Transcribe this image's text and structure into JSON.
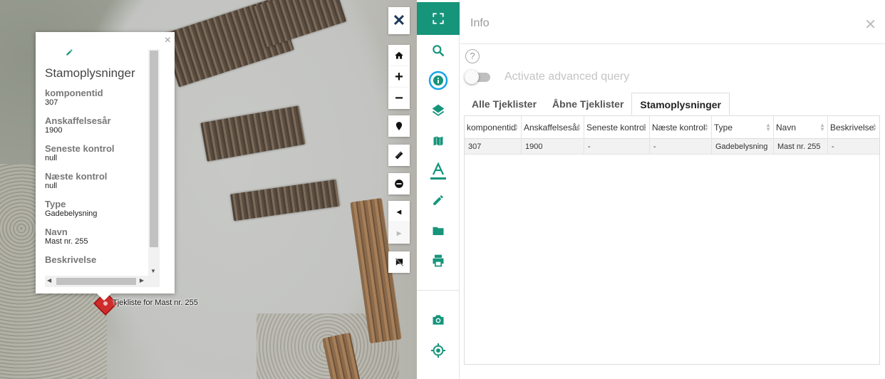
{
  "map": {
    "marker_label": "Tjekliste for Mast nr. 255"
  },
  "popup": {
    "title": "Stamoplysninger",
    "fields": [
      {
        "label": "komponentid",
        "value": "307"
      },
      {
        "label": "Anskaffelsesår",
        "value": "1900"
      },
      {
        "label": "Seneste kontrol",
        "value": "null"
      },
      {
        "label": "Næste kontrol",
        "value": "null"
      },
      {
        "label": "Type",
        "value": "Gadebelysning"
      },
      {
        "label": "Navn",
        "value": "Mast nr. 255"
      },
      {
        "label": "Beskrivelse",
        "value": ""
      }
    ]
  },
  "map_toolbar": {
    "close": "✕",
    "zoom_in": "+",
    "zoom_out": "−",
    "back": "◂",
    "forward": "▸"
  },
  "sidebar": {
    "items": [
      "search-icon",
      "info-icon",
      "layers-icon",
      "map-icon",
      "text-icon",
      "pencil-icon",
      "folder-icon",
      "print-icon",
      "camera-icon",
      "locate-icon"
    ],
    "accent": "#16957b",
    "active_color": "#1aa3e8"
  },
  "info": {
    "title": "Info",
    "help": "?",
    "advanced_query_label": "Activate advanced query",
    "advanced_query_on": false,
    "tabs": [
      "Alle Tjeklister",
      "Åbne Tjeklister",
      "Stamoplysninger"
    ],
    "active_tab": "Stamoplysninger",
    "table": {
      "columns": [
        "komponentid",
        "Anskaffelsesår",
        "Seneste kontrol",
        "Næste kontrol",
        "Type",
        "Navn",
        "Beskrivelse"
      ],
      "rows": [
        [
          "307",
          "1900",
          "-",
          "-",
          "Gadebelysning",
          "Mast nr. 255",
          "-"
        ]
      ]
    }
  }
}
